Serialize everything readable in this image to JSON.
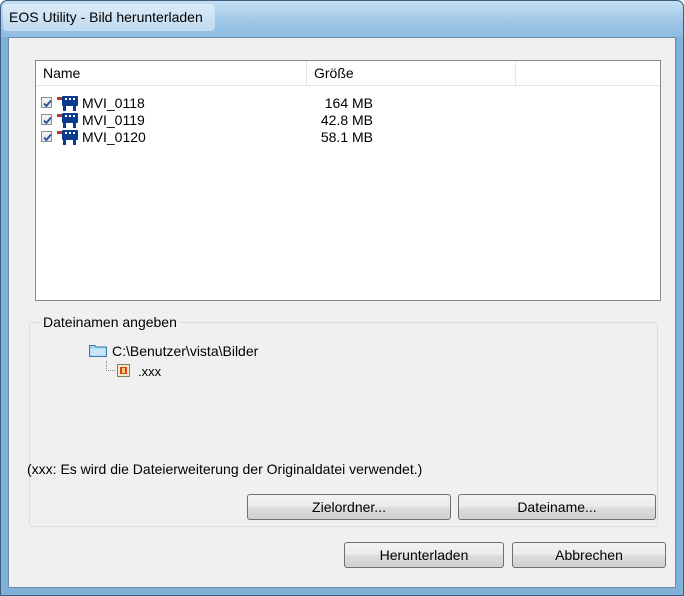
{
  "window": {
    "title": "EOS Utility - Bild herunterladen"
  },
  "file_list": {
    "columns": [
      "Name",
      "Größe"
    ],
    "rows": [
      {
        "name": "MVI_0118",
        "size": "164 MB",
        "checked": true,
        "icon": "movie-icon"
      },
      {
        "name": "MVI_0119",
        "size": "42.8 MB",
        "checked": true,
        "icon": "movie-icon"
      },
      {
        "name": "MVI_0120",
        "size": "58.1 MB",
        "checked": true,
        "icon": "movie-icon"
      }
    ]
  },
  "filename_group": {
    "legend": "Dateinamen angeben",
    "folder_path": "C:\\Benutzer\\vista\\Bilder",
    "file_extension": ".xxx",
    "note": "(xxx: Es wird die Dateierweiterung der Originaldatei verwendet.)"
  },
  "buttons": {
    "target_folder": "Zielordner...",
    "filename": "Dateiname...",
    "download": "Herunterladen",
    "cancel": "Abbrechen"
  },
  "colors": {
    "titlebar": "#9cc5e6",
    "frame": "#7fb0d7",
    "dialog_bg": "#f0f0f0",
    "movie_icon": "#0b3b8c"
  }
}
